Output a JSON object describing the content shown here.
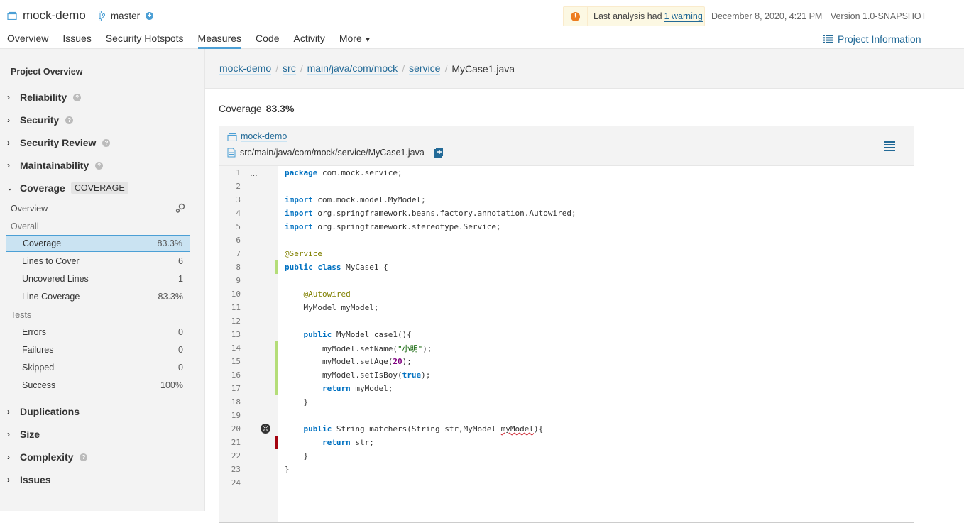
{
  "header": {
    "project_name": "mock-demo",
    "branch": "master",
    "nav": [
      "Overview",
      "Issues",
      "Security Hotspots",
      "Measures",
      "Code",
      "Activity",
      "More"
    ],
    "active_nav": "Measures",
    "warning_prefix": "Last analysis had",
    "warning_link": "1 warning",
    "analysis_date": "December 8, 2020, 4:21 PM",
    "version": "Version 1.0-SNAPSHOT",
    "project_info": "Project Information"
  },
  "sidebar": {
    "title": "Project Overview",
    "domains_top": [
      "Reliability",
      "Security",
      "Security Review",
      "Maintainability"
    ],
    "coverage": {
      "label": "Coverage",
      "badge": "COVERAGE",
      "overview": "Overview",
      "overall_label": "Overall",
      "overall": [
        {
          "label": "Coverage",
          "value": "83.3%"
        },
        {
          "label": "Lines to Cover",
          "value": "6"
        },
        {
          "label": "Uncovered Lines",
          "value": "1"
        },
        {
          "label": "Line Coverage",
          "value": "83.3%"
        }
      ],
      "tests_label": "Tests",
      "tests": [
        {
          "label": "Errors",
          "value": "0"
        },
        {
          "label": "Failures",
          "value": "0"
        },
        {
          "label": "Skipped",
          "value": "0"
        },
        {
          "label": "Success",
          "value": "100%"
        }
      ]
    },
    "domains_bottom": [
      "Duplications",
      "Size",
      "Complexity",
      "Issues"
    ]
  },
  "main": {
    "breadcrumb": [
      "mock-demo",
      "src",
      "main/java/com/mock",
      "service",
      "MyCase1.java"
    ],
    "coverage_label": "Coverage",
    "coverage_value": "83.3%",
    "viewer_project": "mock-demo",
    "viewer_file": "src/main/java/com/mock/service/MyCase1.java"
  },
  "code": {
    "lines": [
      {
        "n": "1",
        "cov": ""
      },
      {
        "n": "2",
        "cov": ""
      },
      {
        "n": "3",
        "cov": ""
      },
      {
        "n": "4",
        "cov": ""
      },
      {
        "n": "5",
        "cov": ""
      },
      {
        "n": "6",
        "cov": ""
      },
      {
        "n": "7",
        "cov": ""
      },
      {
        "n": "8",
        "cov": "covered"
      },
      {
        "n": "9",
        "cov": ""
      },
      {
        "n": "10",
        "cov": ""
      },
      {
        "n": "11",
        "cov": ""
      },
      {
        "n": "12",
        "cov": ""
      },
      {
        "n": "13",
        "cov": ""
      },
      {
        "n": "14",
        "cov": "covered"
      },
      {
        "n": "15",
        "cov": "covered"
      },
      {
        "n": "16",
        "cov": "covered"
      },
      {
        "n": "17",
        "cov": "covered"
      },
      {
        "n": "18",
        "cov": ""
      },
      {
        "n": "19",
        "cov": ""
      },
      {
        "n": "20",
        "cov": "",
        "issue": true
      },
      {
        "n": "21",
        "cov": "uncovered"
      },
      {
        "n": "22",
        "cov": ""
      },
      {
        "n": "23",
        "cov": ""
      },
      {
        "n": "24",
        "cov": ""
      }
    ],
    "t": {
      "package": "package",
      "pkg_rest": " com.mock.service;",
      "import": "import",
      "imp1": " com.mock.model.MyModel;",
      "imp2": " org.springframework.beans.factory.annotation.Autowired;",
      "imp3": " org.springframework.stereotype.Service;",
      "ann_service": "@Service",
      "public": "public",
      "class": "class",
      "cls_rest": " MyCase1 {",
      "ann_autowired": "@Autowired",
      "field": "MyModel myModel;",
      "m1_rest": " MyModel case1(){",
      "l14a": "myModel.setName(",
      "l14s": "\"小明\"",
      "l14b": ");",
      "l15a": "myModel.setAge(",
      "l15n": "20",
      "l15b": ");",
      "l16a": "myModel.setIsBoy(",
      "true": "true",
      "l16b": ");",
      "return": "return",
      "l17rest": " myModel;",
      "close": "}",
      "m2a": " String matchers(String str,MyModel ",
      "m2p": "myModel",
      "m2b": "){",
      "l21rest": " str;"
    }
  }
}
